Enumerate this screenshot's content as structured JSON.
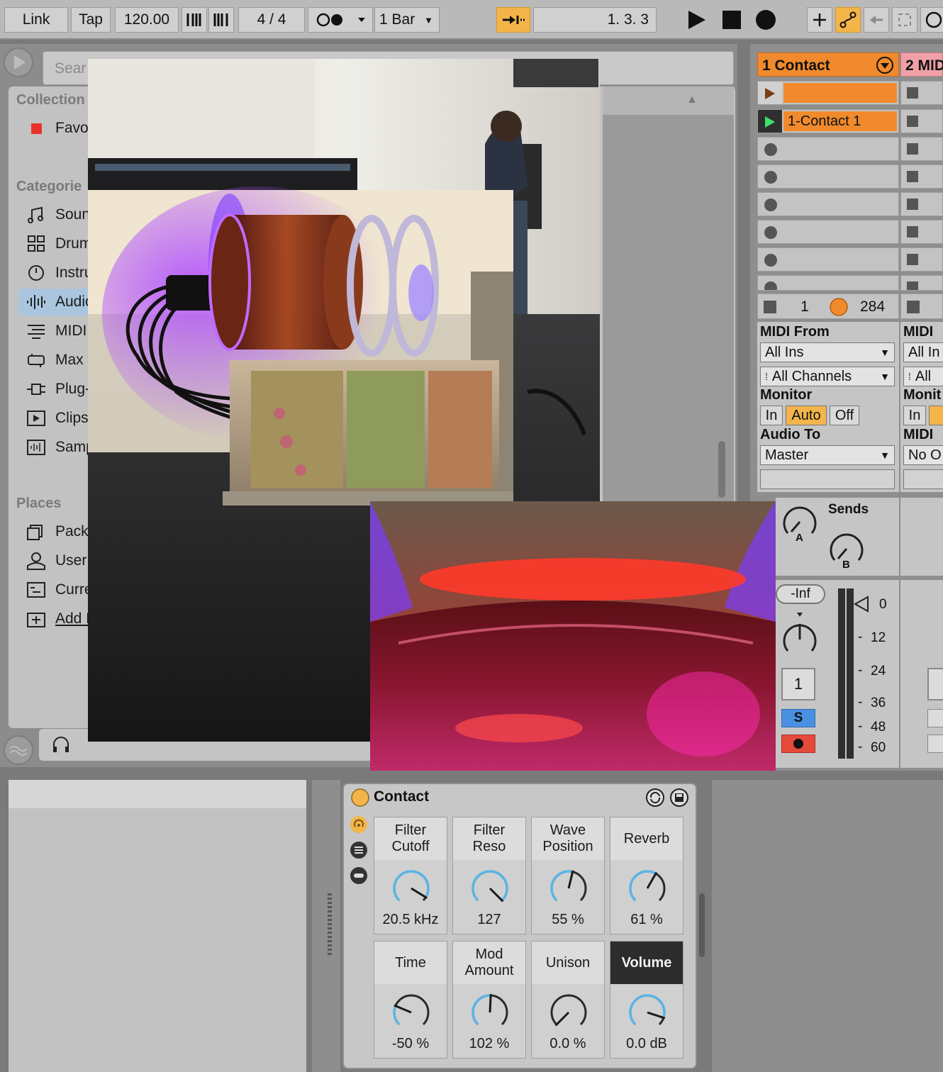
{
  "transport": {
    "link": "Link",
    "tap": "Tap",
    "tempo": "120.00",
    "time_signature": "4  /  4",
    "quantize": "1 Bar",
    "position": "1.  3.  3"
  },
  "browser": {
    "search_placeholder": "Sear",
    "collections_heading": "Collection",
    "favorites": "Favor",
    "categories_heading": "Categorie",
    "categories": [
      "Sounc",
      "Drum",
      "Instru",
      "Audio",
      "MIDI E",
      "Max f",
      "Plug-I",
      "Clips",
      "Samp"
    ],
    "places_heading": "Places",
    "places": [
      "Packs",
      "User L",
      "Curre",
      "Add F"
    ]
  },
  "session": {
    "track1_name": "1 Contact",
    "track2_name": "2 MID",
    "clip_name": "1-Contact 1",
    "footer_num": "1",
    "footer_count": "284",
    "midi_from_label": "MIDI From",
    "midi_from_value": "All Ins",
    "channels_value": "All Channels",
    "monitor_label": "Monitor",
    "monitor_in": "In",
    "monitor_auto": "Auto",
    "monitor_off": "Off",
    "audio_to_label": "Audio To",
    "audio_to_value": "Master",
    "track2_midi_label": "MIDI",
    "track2_from": "All In",
    "track2_channels": "All",
    "track2_monitor": "Monit",
    "track2_in": "In",
    "track2_midi_to": "MIDI",
    "track2_out": "No O",
    "sends_label": "Sends",
    "send_a": "A",
    "send_b": "B",
    "volume_readout": "-Inf",
    "track_number": "1",
    "solo": "S",
    "meter_scale": [
      "0",
      "12",
      "24",
      "36",
      "48",
      "60"
    ]
  },
  "device": {
    "name": "Contact",
    "macros": [
      {
        "label": "Filter\nCutoff",
        "value": "20.5 kHz",
        "amount": 0.95
      },
      {
        "label": "Filter\nReso",
        "value": "127",
        "amount": 1.0
      },
      {
        "label": "Wave\nPosition",
        "value": "55 %",
        "amount": 0.55
      },
      {
        "label": "Reverb",
        "value": "61 %",
        "amount": 0.61
      },
      {
        "label": "Time",
        "value": "-50 %",
        "amount": 0.25
      },
      {
        "label": "Mod\nAmount",
        "value": "102 %",
        "amount": 0.51
      },
      {
        "label": "Unison",
        "value": "0.0 %",
        "amount": 0.0
      },
      {
        "label": "Volume",
        "value": "0.0 dB",
        "amount": 0.9
      }
    ]
  },
  "colors": {
    "accent_orange": "#f08a2c",
    "clip_yellow": "#f3b54a",
    "knob_blue": "#5ab4e6",
    "solo_blue": "#4a90e2",
    "arm_red": "#e54a3b"
  }
}
